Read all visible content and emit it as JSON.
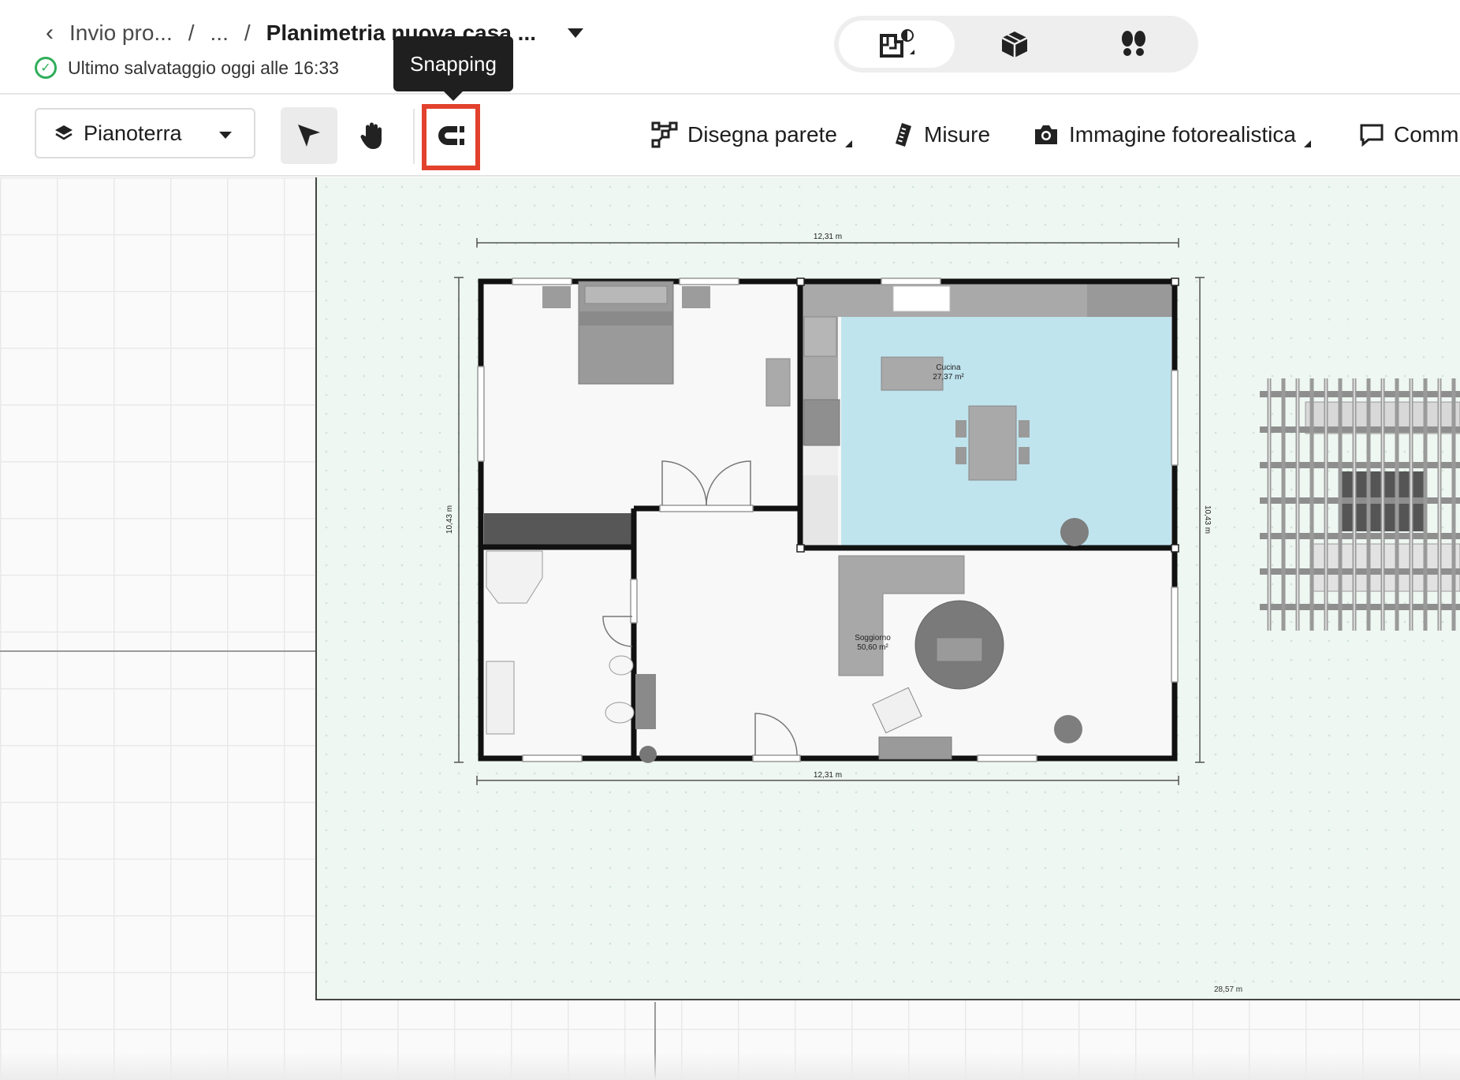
{
  "header": {
    "breadcrumb": {
      "back_icon": "chevron-left-icon",
      "project": "Invio pro...",
      "separator": "/",
      "ellipsis": "...",
      "title": "Planimetria nuova casa ..."
    },
    "save_status": "Ultimo salvataggio oggi alle 16:33",
    "view_modes": [
      {
        "name": "2D",
        "icon": "floorplan-2d-icon",
        "active": true
      },
      {
        "name": "3D",
        "icon": "cube-3d-icon",
        "active": false
      },
      {
        "name": "Walkthrough",
        "icon": "footsteps-icon",
        "active": false
      }
    ]
  },
  "toolbar": {
    "floor": "Pianoterra",
    "tools": [
      {
        "name": "select",
        "icon": "cursor-arrow-icon",
        "active": true
      },
      {
        "name": "pan",
        "icon": "hand-icon",
        "active": false
      },
      {
        "name": "snapping",
        "icon": "magnet-icon",
        "active": false
      }
    ],
    "tooltip": "Snapping",
    "draw_wall": "Disegna parete",
    "measures": "Misure",
    "photo": "Immagine fotorealistica",
    "comments": "Comm"
  },
  "canvas": {
    "dim_top": "12,31 m",
    "dim_bottom": "12,31 m",
    "dim_left": "10,43 m",
    "dim_right": "10,43 m",
    "lot_width": "28,57 m",
    "rooms": [
      {
        "name": "Cucina",
        "area": "27,37 m²",
        "color": "#bfe4ee"
      },
      {
        "name": "Soggiorno",
        "area": "50,60 m²",
        "color": "#f8f8f8"
      }
    ],
    "colors": {
      "accent_highlight": "#e2422d",
      "lot": "#eef7f1",
      "wall": "#111111"
    }
  }
}
